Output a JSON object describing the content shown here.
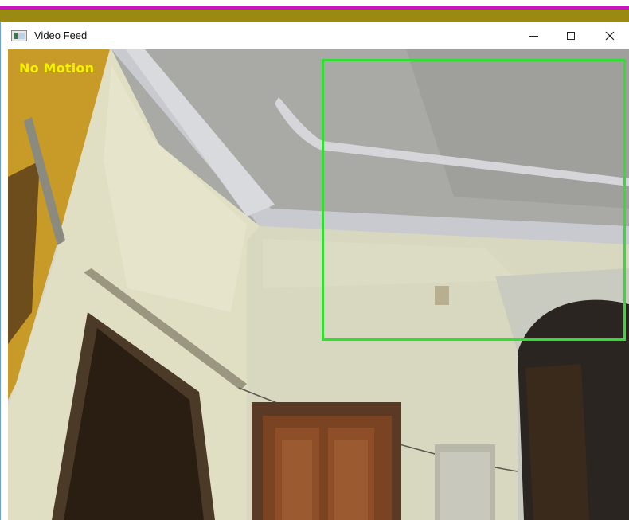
{
  "window": {
    "title": "Video Feed",
    "controls": {
      "minimize": "—",
      "maximize": "☐",
      "close": "✕"
    }
  },
  "overlay": {
    "status_text": "No Motion",
    "status_color": "#f3f000",
    "box_color": "#33dd33"
  },
  "colors": {
    "top_stripe": "#c813c8",
    "second_stripe": "#9a8a12"
  }
}
